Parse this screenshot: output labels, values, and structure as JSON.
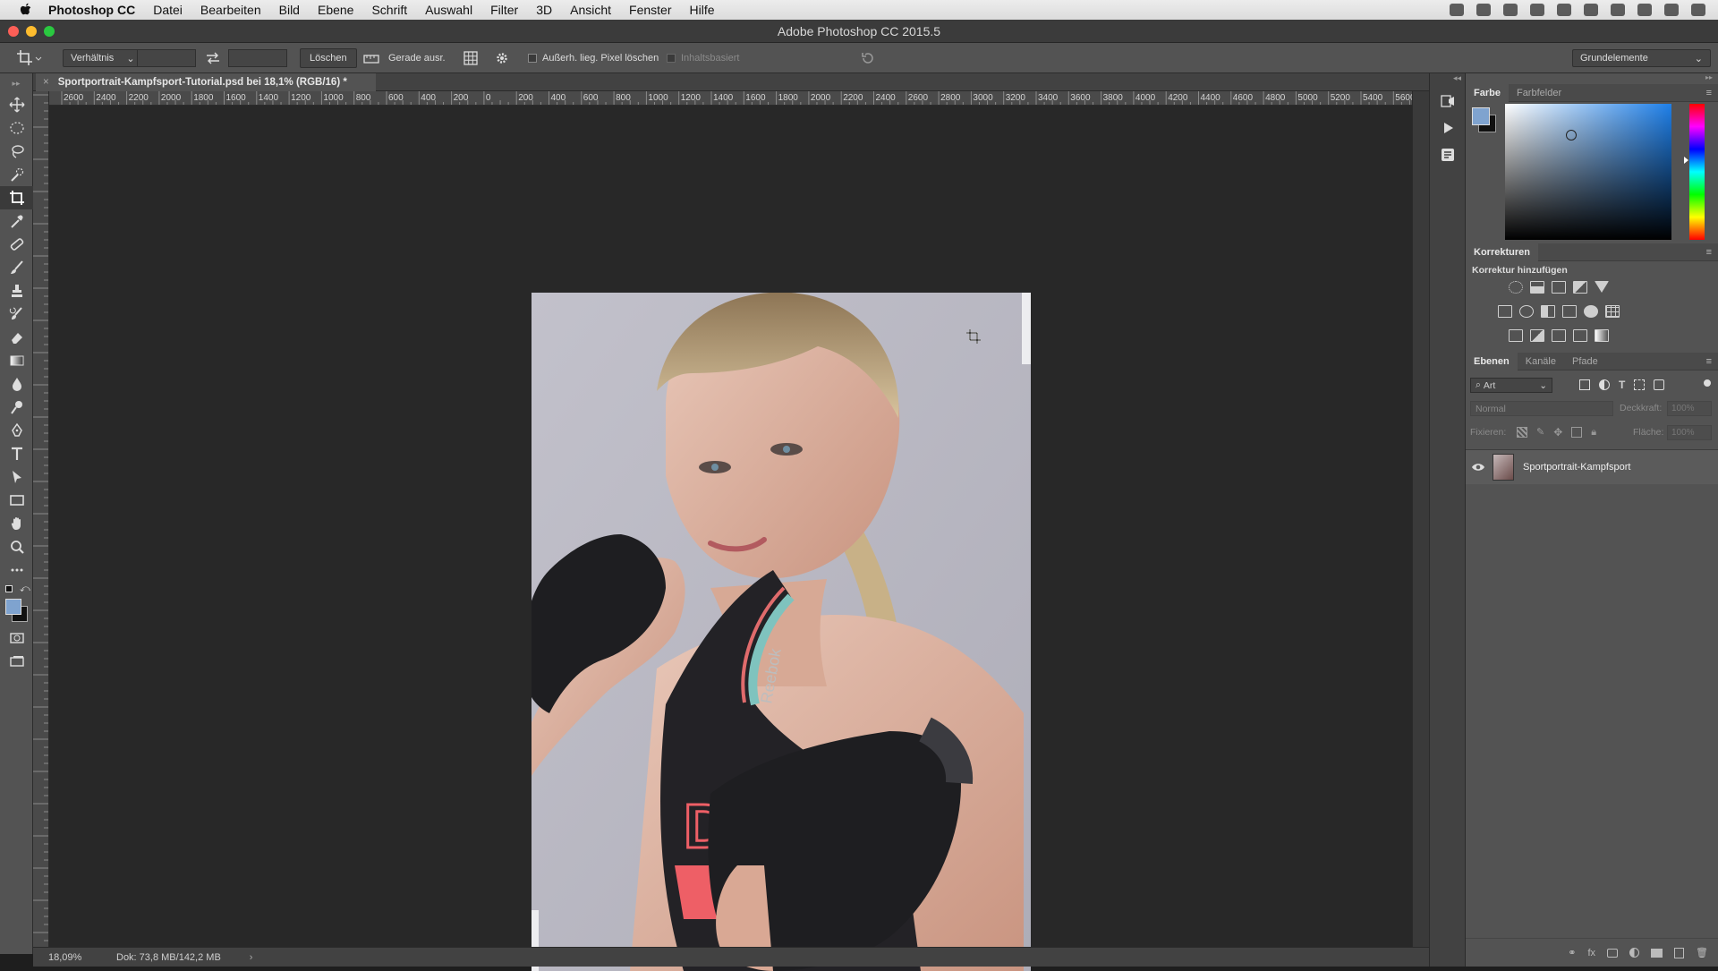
{
  "menubar": {
    "app_name": "Photoshop CC",
    "items": [
      "Datei",
      "Bearbeiten",
      "Bild",
      "Ebene",
      "Schrift",
      "Auswahl",
      "Filter",
      "3D",
      "Ansicht",
      "Fenster",
      "Hilfe"
    ]
  },
  "window": {
    "title": "Adobe Photoshop CC 2015.5"
  },
  "options": {
    "ratio_select": "Verhältnis",
    "clear_button": "Löschen",
    "straighten_label": "Gerade ausr.",
    "delete_cropped_label": "Außerh. lieg. Pixel löschen",
    "content_aware_label": "Inhaltsbasiert",
    "workspace_select": "Grundelemente"
  },
  "document": {
    "tab_title": "Sportportrait-Kampfsport-Tutorial.psd bei 18,1% (RGB/16) *",
    "zoom": "18,09%",
    "doc_info": "Dok: 73,8 MB/142,2 MB"
  },
  "rulers": {
    "horizontal": [
      "2600",
      "2400",
      "2200",
      "2000",
      "1800",
      "1600",
      "1400",
      "1200",
      "1000",
      "800",
      "600",
      "400",
      "200",
      "0",
      "200",
      "400",
      "600",
      "800",
      "1000",
      "1200",
      "1400",
      "1600",
      "1800",
      "2000",
      "2200",
      "2400",
      "2600",
      "2800",
      "3000",
      "3200",
      "3400",
      "3600",
      "3800",
      "4000",
      "4200",
      "4400",
      "4600",
      "4800",
      "5000",
      "5200",
      "5400",
      "5600"
    ]
  },
  "panels": {
    "color": {
      "tabs": [
        "Farbe",
        "Farbfelder"
      ],
      "foreground": "#7fa3cf",
      "background": "#111111"
    },
    "adjustments": {
      "title": "Korrekturen",
      "subtitle": "Korrektur hinzufügen"
    },
    "layers": {
      "tabs": [
        "Ebenen",
        "Kanäle",
        "Pfade"
      ],
      "filter_kind": "Art",
      "blend_mode": "Normal",
      "opacity_label": "Deckkraft:",
      "opacity_value": "100%",
      "lock_label": "Fixieren:",
      "fill_label": "Fläche:",
      "fill_value": "100%",
      "layer_name": "Sportportrait-Kampfsport"
    }
  },
  "photo": {
    "shirt_brand": "Reebok"
  }
}
